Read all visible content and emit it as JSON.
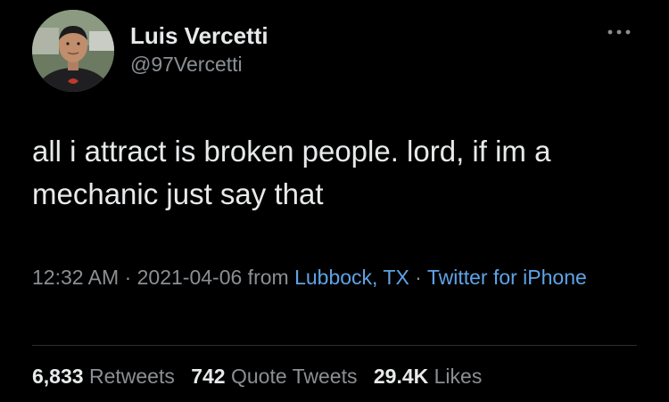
{
  "author": {
    "name": "Luis Vercetti",
    "handle": "@97Vercetti"
  },
  "tweet": {
    "text": "all i attract is broken people. lord, if im a mechanic just say that"
  },
  "meta": {
    "time": "12:32 AM",
    "separator": " · ",
    "date": "2021-04-06",
    "from_label": " from ",
    "location": "Lubbock, TX",
    "source": "Twitter for iPhone"
  },
  "stats": {
    "retweets_count": "6,833",
    "retweets_label": "Retweets",
    "quotes_count": "742",
    "quotes_label": "Quote Tweets",
    "likes_count": "29.4K",
    "likes_label": "Likes"
  },
  "icons": {
    "more": "more-horizontal-icon"
  },
  "colors": {
    "background": "#000000",
    "primary_text": "#e7e9ea",
    "secondary_text": "#8b8f93",
    "link": "#5fa3e6"
  }
}
